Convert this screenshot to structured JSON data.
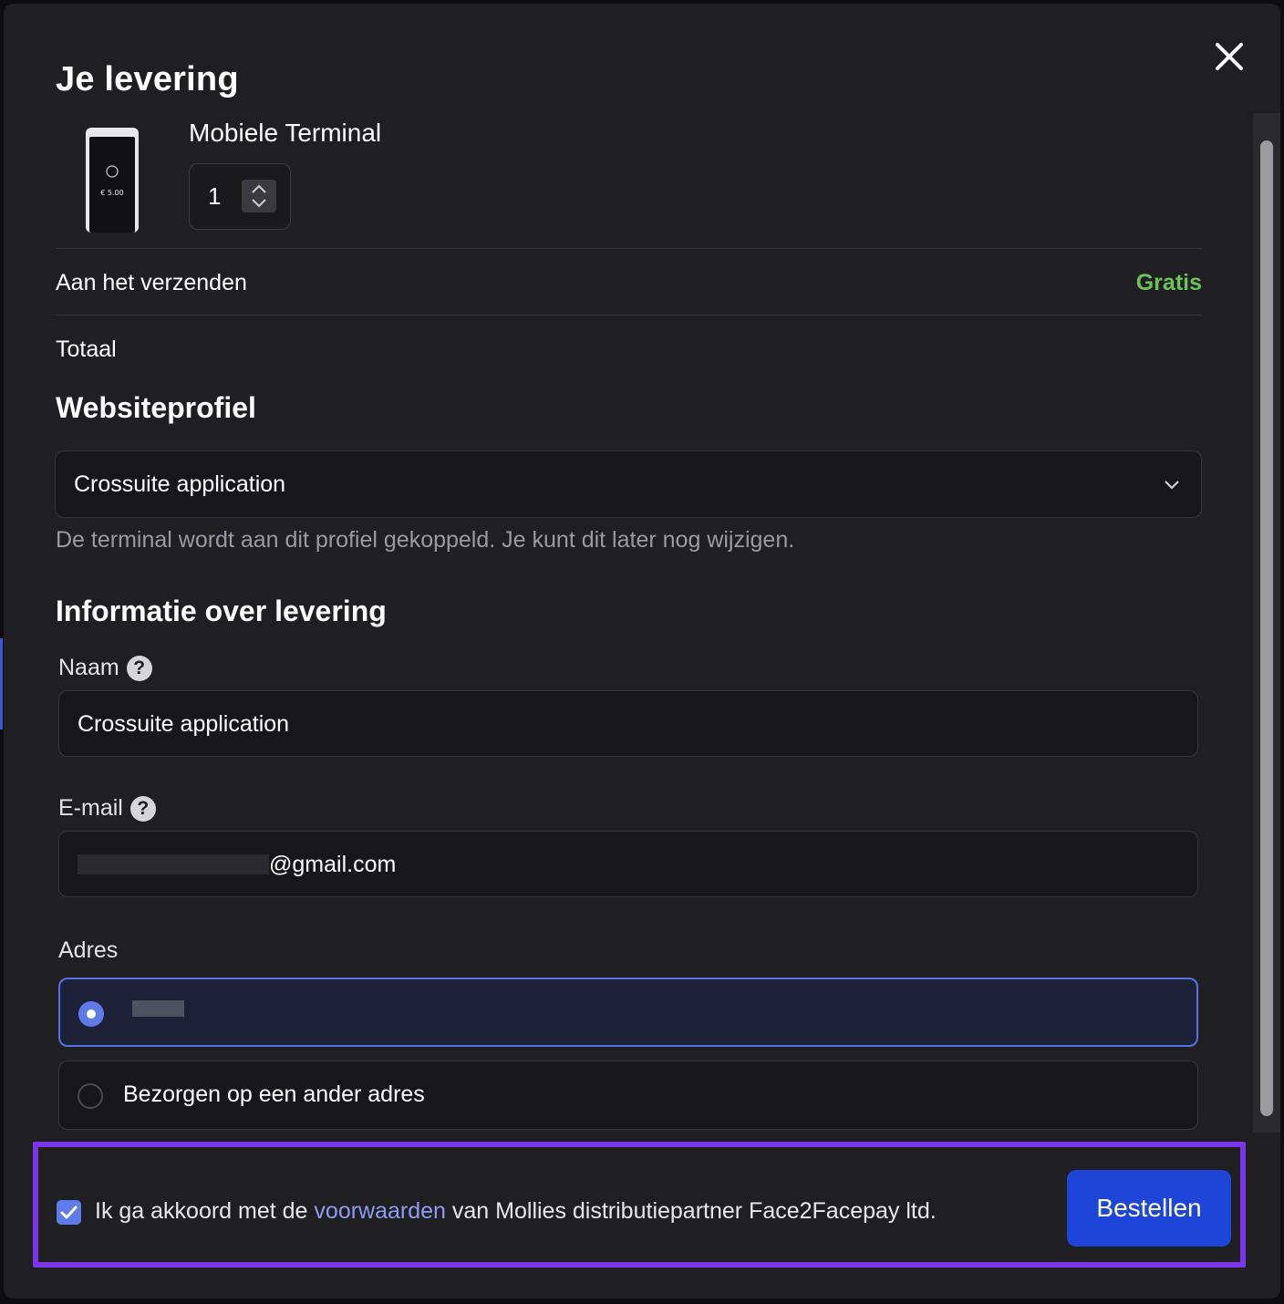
{
  "modal": {
    "title": "Je levering",
    "close_icon": "close-icon"
  },
  "product": {
    "name": "Mobiele Terminal",
    "quantity": "1",
    "screen_amount": "€ 5.00"
  },
  "summary": {
    "shipping_label": "Aan het verzenden",
    "shipping_value": "Gratis",
    "total_label": "Totaal"
  },
  "website_profile": {
    "title": "Websiteprofiel",
    "selected": "Crossuite application",
    "helper": "De terminal wordt aan dit profiel gekoppeld. Je kunt dit later nog wijzigen."
  },
  "delivery": {
    "title": "Informatie over levering",
    "name_label": "Naam",
    "name_value": "Crossuite application",
    "email_label": "E-mail",
    "email_value_suffix": "@gmail.com",
    "address_label": "Adres",
    "alt_address_label": "Bezorgen op een ander adres"
  },
  "footer": {
    "agree_prefix": "Ik ga akkoord met de",
    "agree_link": "voorwaarden",
    "agree_suffix": "van Mollies distributiepartner Face2Facepay ltd.",
    "checked": true,
    "order_button": "Bestellen"
  },
  "colors": {
    "accent": "#5f7bea",
    "button": "#1d46d8",
    "free": "#6cc25a",
    "highlight_border": "#7a35e8"
  }
}
